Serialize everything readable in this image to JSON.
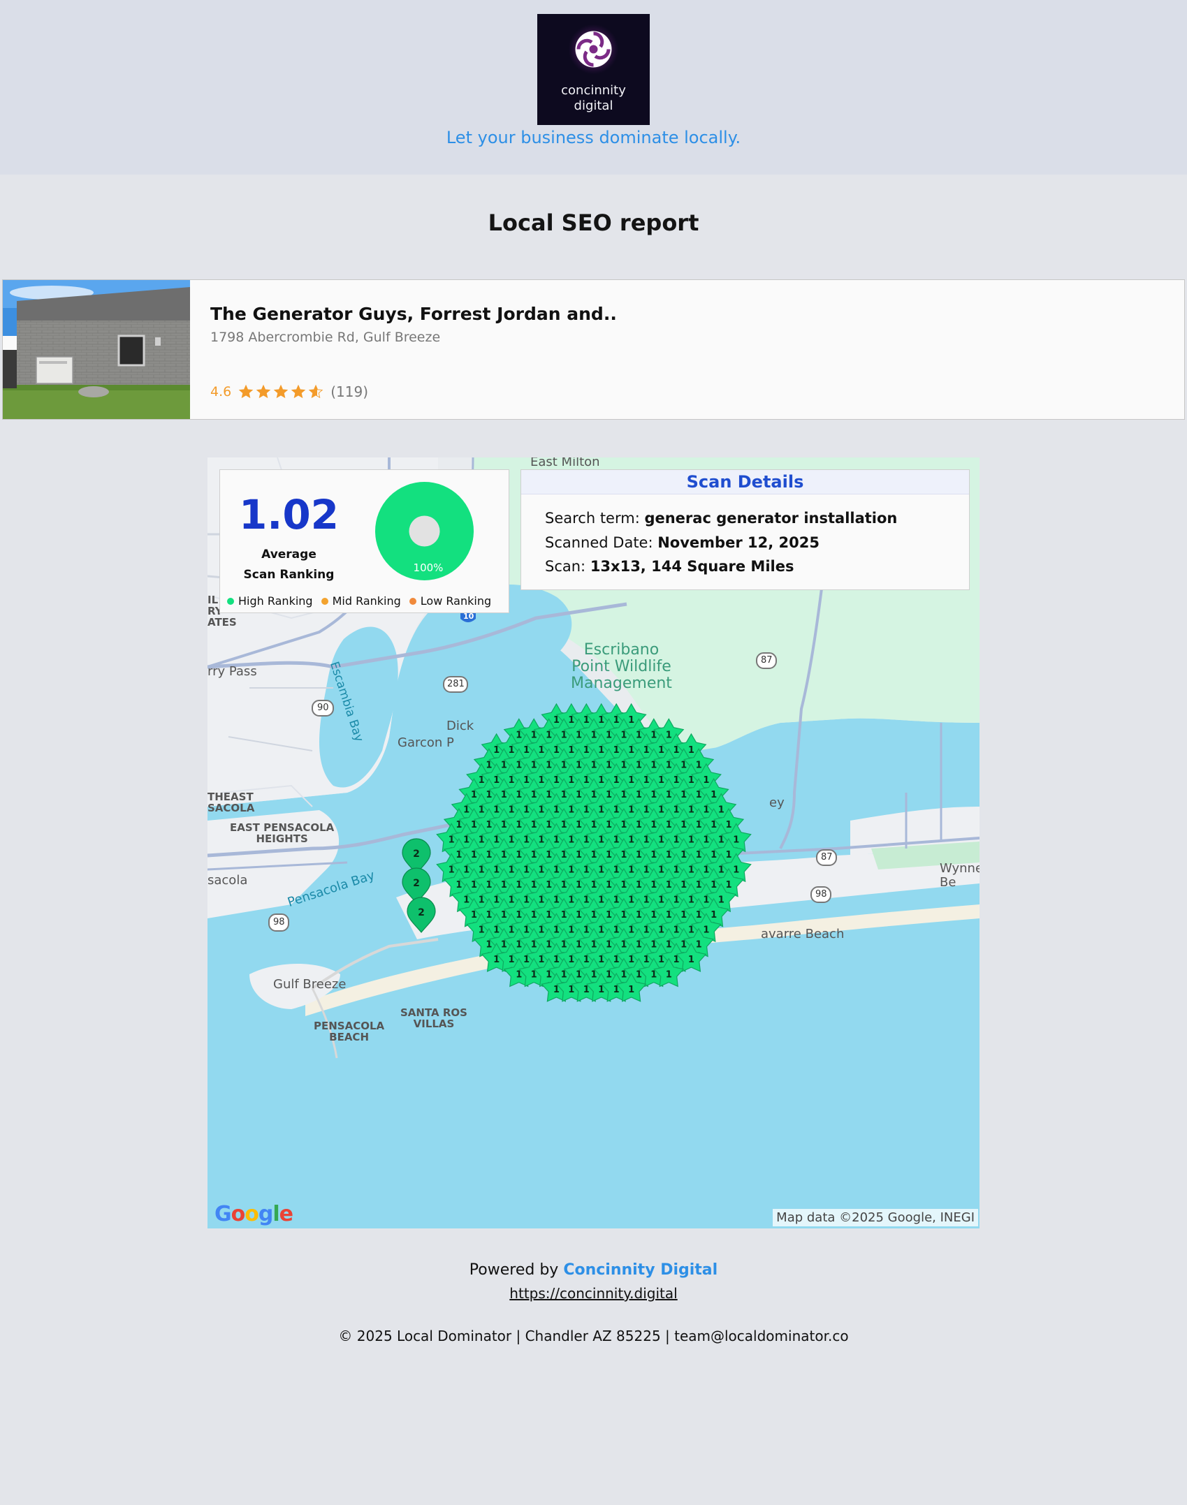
{
  "header": {
    "logo": {
      "line1": "concinnity",
      "line2": "digital"
    },
    "tagline": "Let your business dominate locally."
  },
  "report": {
    "title": "Local SEO report"
  },
  "business": {
    "name": "The Generator Guys, Forrest Jordan and..",
    "address": "1798 Abercrombie Rd, Gulf Breeze",
    "rating": "4.6",
    "stars": 4.6,
    "reviews": "(119)"
  },
  "ranking": {
    "average": "1.02",
    "average_label_1": "Average",
    "average_label_2": "Scan Ranking",
    "donut_percent": "100%",
    "donut_fraction": 1.0,
    "legend": [
      {
        "label": "High Ranking",
        "color": "#13e07f"
      },
      {
        "label": "Mid Ranking",
        "color": "#f3a32f"
      },
      {
        "label": "Low Ranking",
        "color": "#f08a3c"
      }
    ]
  },
  "scan": {
    "title": "Scan Details",
    "search_term_label": "Search term: ",
    "search_term": "generac generator installation",
    "date_label": "Scanned Date: ",
    "date": "November 12, 2025",
    "scan_label": "Scan: ",
    "scan_value": "13x13, 144 Square Miles"
  },
  "map": {
    "labels": {
      "east_milton": "East Milton",
      "escribano": "Escribano\nPoint Wildlife\nManagement",
      "escambia_bay": "Escambia Bay",
      "ferry_pass": "rry Pass",
      "garcon": "Garcon P",
      "dick": "Dick",
      "east_pensacola": "EAST PENSACOLA\nHEIGHTS",
      "theast": "THEAST\nSACOLA",
      "pensacola": "sacola",
      "pensacola_bay": "Pensacola Bay",
      "gulf_breeze": "Gulf Breeze",
      "santa_rosa": "SANTA ROS\nVILLAS",
      "pensacola_beach": "PENSACOLA\nBEACH",
      "navarre_beach": "avarre Beach",
      "wynne": "Wynne\nBe",
      "ey": "ey",
      "ates": "ATES",
      "il": "IL\nRY",
      "shield_90": "90",
      "shield_281": "281",
      "shield_87a": "87",
      "shield_87b": "87",
      "shield_98a": "98",
      "shield_98b": "98",
      "shield_10": "10"
    },
    "google": "Google",
    "attribution": "Map data ©2025 Google, INEGI",
    "pin_grid": {
      "rows": 13,
      "cols": 13,
      "rank_value": "1",
      "outlier_rank": "2",
      "outlier_count": 3
    }
  },
  "footer": {
    "powered_prefix": "Powered by ",
    "powered_brand": "Concinnity Digital",
    "url": "https://concinnity.digital",
    "copyright": "© 2025 Local Dominator | Chandler AZ 85225 | team@localdominator.co"
  },
  "colors": {
    "accent": "#2d8fe6",
    "rank_green": "#13e07f",
    "title_blue": "#1737c9"
  }
}
